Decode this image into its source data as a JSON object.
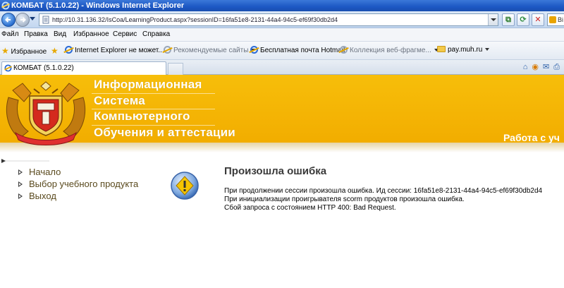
{
  "window": {
    "title": "КОМБАТ (5.1.0.22) - Windows Internet Explorer"
  },
  "address": {
    "url": "http://10.31.136.32/IsCoa/LearningProduct.aspx?sessionID=16fa51e8-2131-44a4-94c5-ef69f30db2d4",
    "search_stub": "Bi"
  },
  "menu": {
    "items": [
      "Файл",
      "Правка",
      "Вид",
      "Избранное",
      "Сервис",
      "Справка"
    ]
  },
  "favorites": {
    "label": "Избранное",
    "items": [
      {
        "label": "Internet Explorer не может..."
      },
      {
        "label": "Рекомендуемые сайты"
      },
      {
        "label": "Бесплатная почта Hotmail"
      },
      {
        "label": "Коллекция веб-фрагме..."
      },
      {
        "label": "pay.muh.ru"
      }
    ]
  },
  "tabs": [
    {
      "label": "КОМБАТ (5.1.0.22)"
    }
  ],
  "banner": {
    "line1": "Информационная",
    "line2": "Система",
    "line3": "Компьютерного",
    "line4": "Обучения и аттестации",
    "right_text": "Работа с уч"
  },
  "leftmenu": {
    "items": [
      "Начало",
      "Выбор учебного продукта",
      "Выход"
    ]
  },
  "error": {
    "title": "Произошла ошибка",
    "line1": "При продолжении сессии произошла ошибка. Ид сессии: 16fa51e8-2131-44a4-94c5-ef69f30db2d4",
    "line2": "При инициализации проигрывателя scorm продуктов произошла ошибка.",
    "line3": "Сбой запроса с состоянием HTTP 400: Bad Request."
  },
  "colors": {
    "banner": "#f2ad00",
    "menu_text": "#5a4a1e",
    "titlebar": "#1c57c4"
  }
}
